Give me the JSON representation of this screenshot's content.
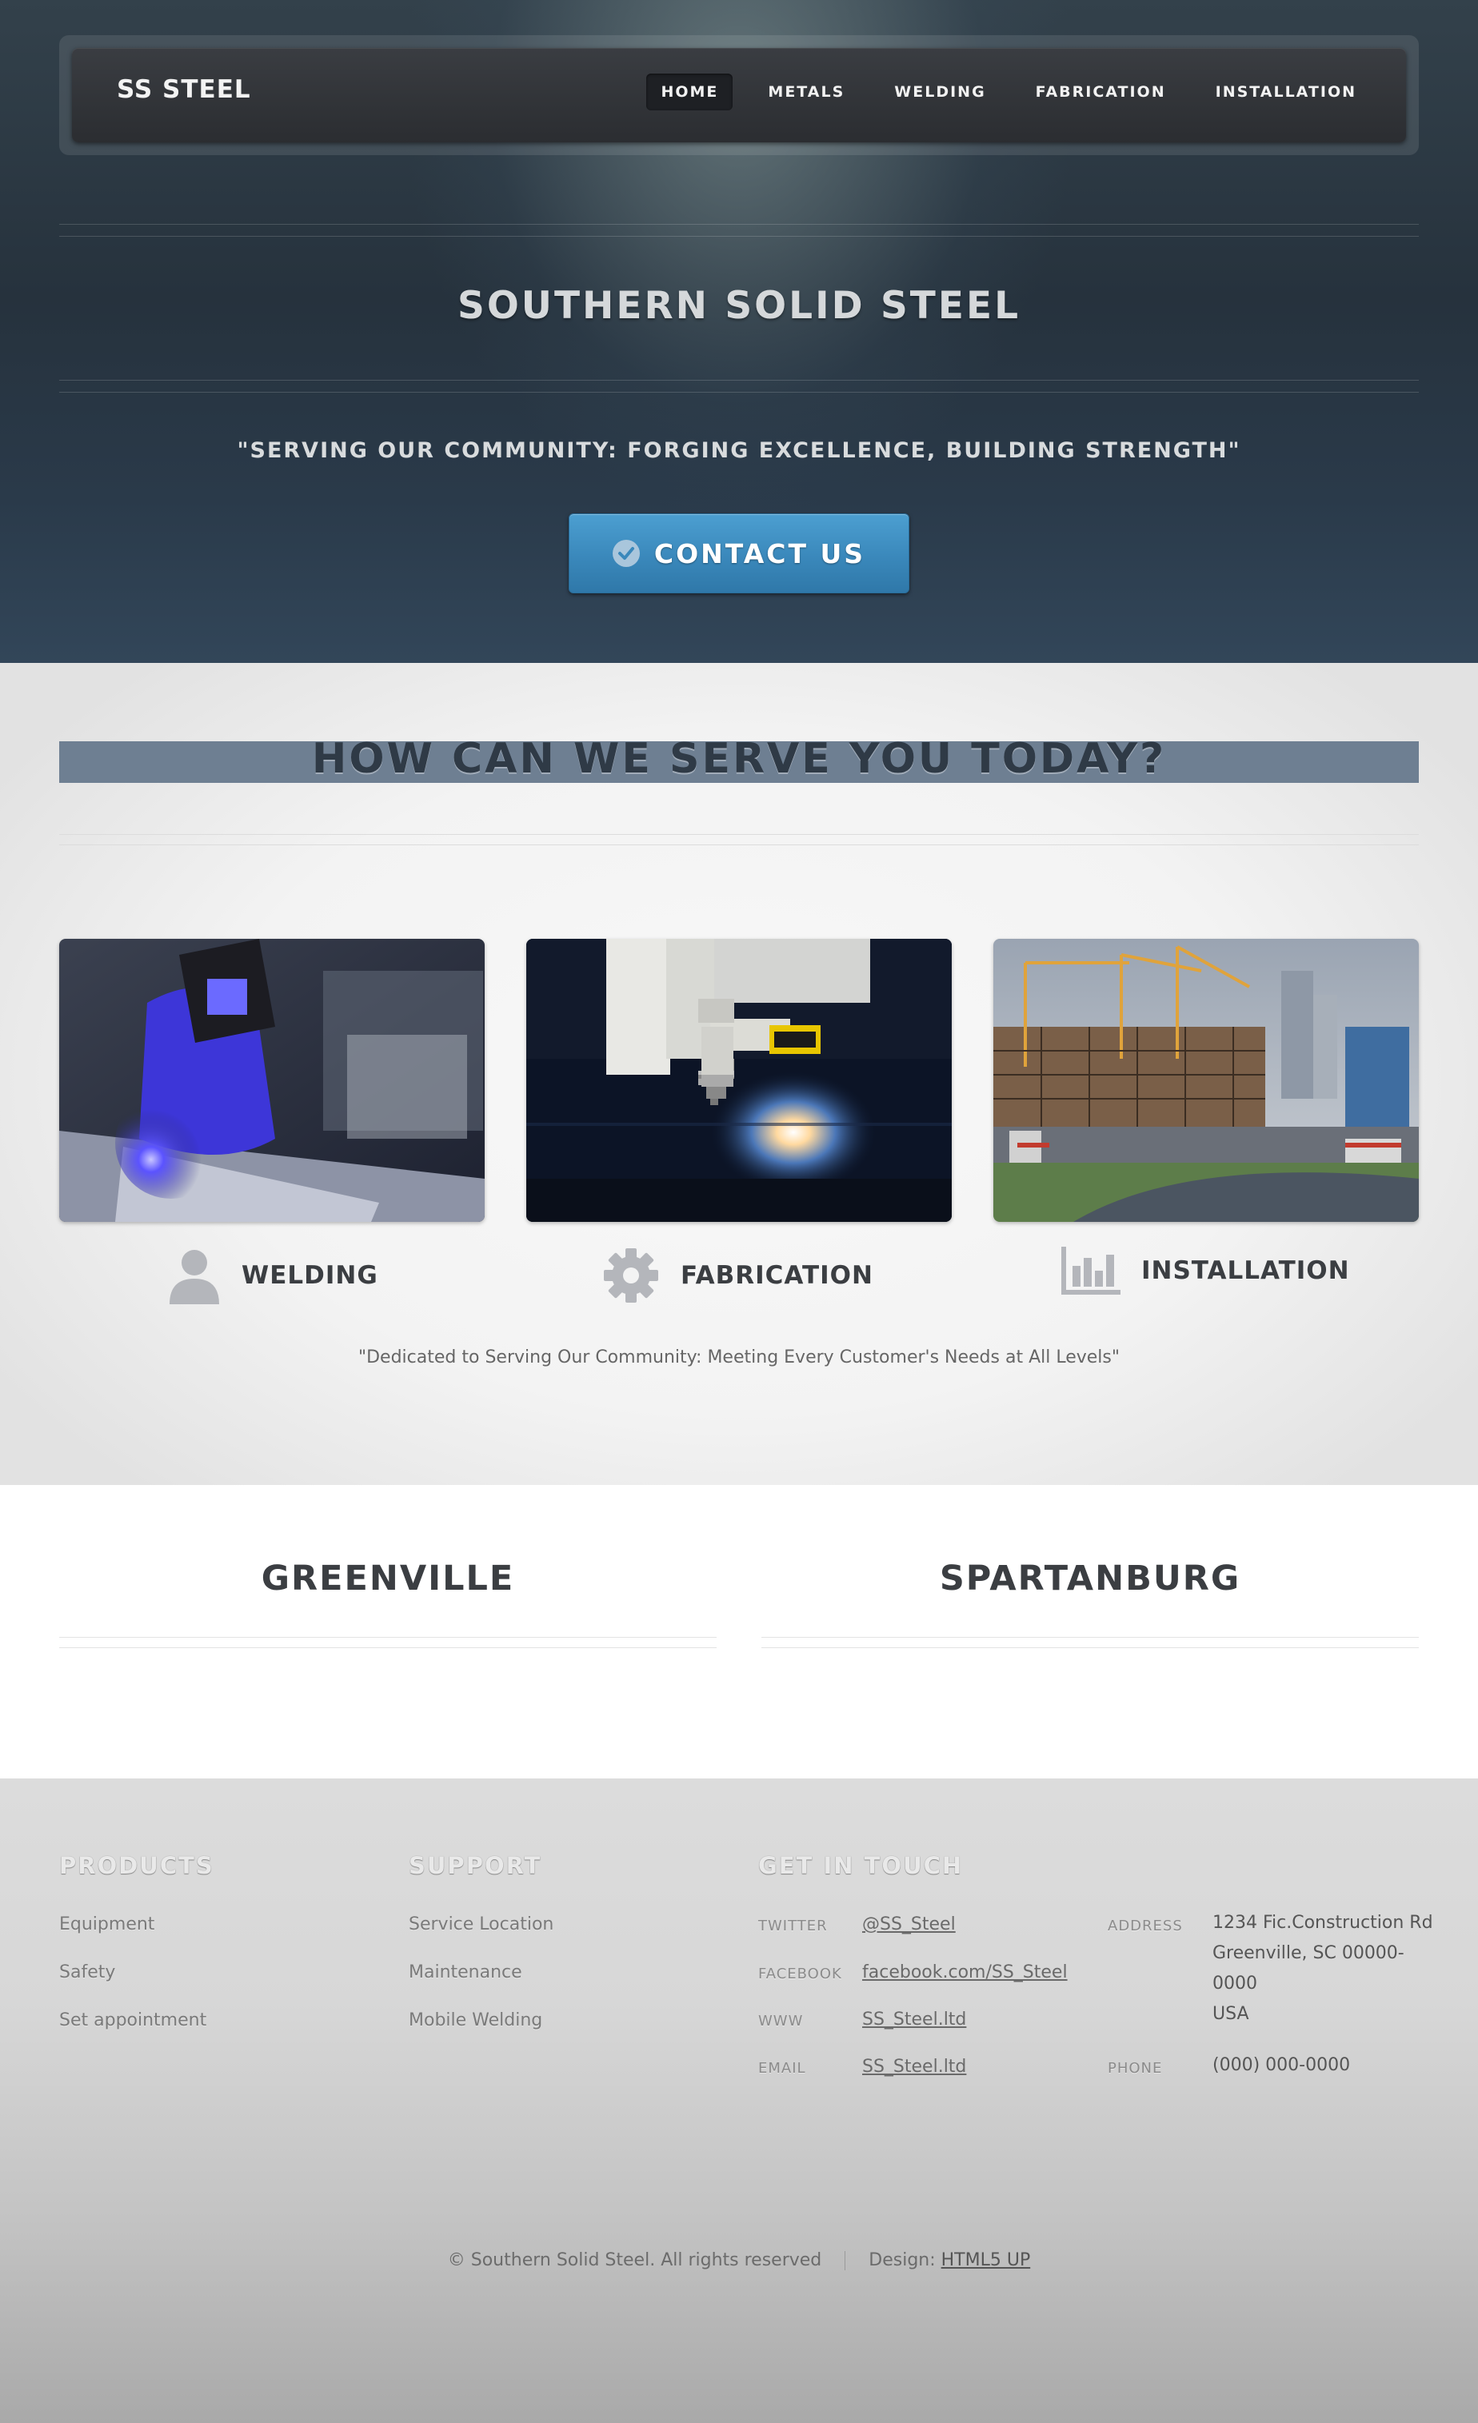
{
  "nav": {
    "logo": "SS STEEL",
    "items": [
      {
        "label": "HOME",
        "active": true
      },
      {
        "label": "METALS",
        "active": false
      },
      {
        "label": "WELDING",
        "active": false
      },
      {
        "label": "FABRICATION",
        "active": false
      },
      {
        "label": "INSTALLATION",
        "active": false
      }
    ]
  },
  "hero": {
    "title": "SOUTHERN SOLID STEEL",
    "tagline": "\"SERVING OUR COMMUNITY: FORGING EXCELLENCE, BUILDING STRENGTH\"",
    "cta_label": "CONTACT US",
    "cta_icon": "check-circle-icon"
  },
  "services": {
    "heading": "HOW CAN WE SERVE YOU TODAY?",
    "items": [
      {
        "label": "WELDING",
        "icon": "user-icon",
        "image": "welder-photo"
      },
      {
        "label": "FABRICATION",
        "icon": "gear-icon",
        "image": "laser-cutter-photo"
      },
      {
        "label": "INSTALLATION",
        "icon": "bar-chart-icon",
        "image": "construction-site-photo"
      }
    ],
    "quote": "\"Dedicated to Serving Our Community: Meeting Every Customer's Needs at All Levels\""
  },
  "locations": [
    "GREENVILLE",
    "SPARTANBURG"
  ],
  "footer": {
    "products": {
      "heading": "PRODUCTS",
      "links": [
        "Equipment",
        "Safety",
        "Set appointment"
      ]
    },
    "support": {
      "heading": "SUPPORT",
      "links": [
        "Service Location",
        "Maintenance",
        "Mobile Welding"
      ]
    },
    "contact": {
      "heading": "GET IN TOUCH",
      "rows": [
        {
          "key": "TWITTER",
          "value": "@SS_Steel"
        },
        {
          "key": "FACEBOOK",
          "value": "facebook.com/SS_Steel"
        },
        {
          "key": "WWW",
          "value": "SS_Steel.ltd"
        },
        {
          "key": "EMAIL",
          "value": "SS_Steel.ltd"
        }
      ],
      "address_key": "ADDRESS",
      "address_lines": [
        "1234 Fic.Construction Rd",
        "Greenville, SC 00000-",
        "0000",
        "USA"
      ],
      "phone_key": "PHONE",
      "phone": "(000) 000-0000"
    },
    "copyright": "© Southern Solid Steel. All rights reserved",
    "design_label": "Design:",
    "design_link": "HTML5 UP"
  },
  "colors": {
    "accent_button": "#3a88bb",
    "serve_bar": "#6e7f92",
    "header_dark": "#26323d"
  }
}
